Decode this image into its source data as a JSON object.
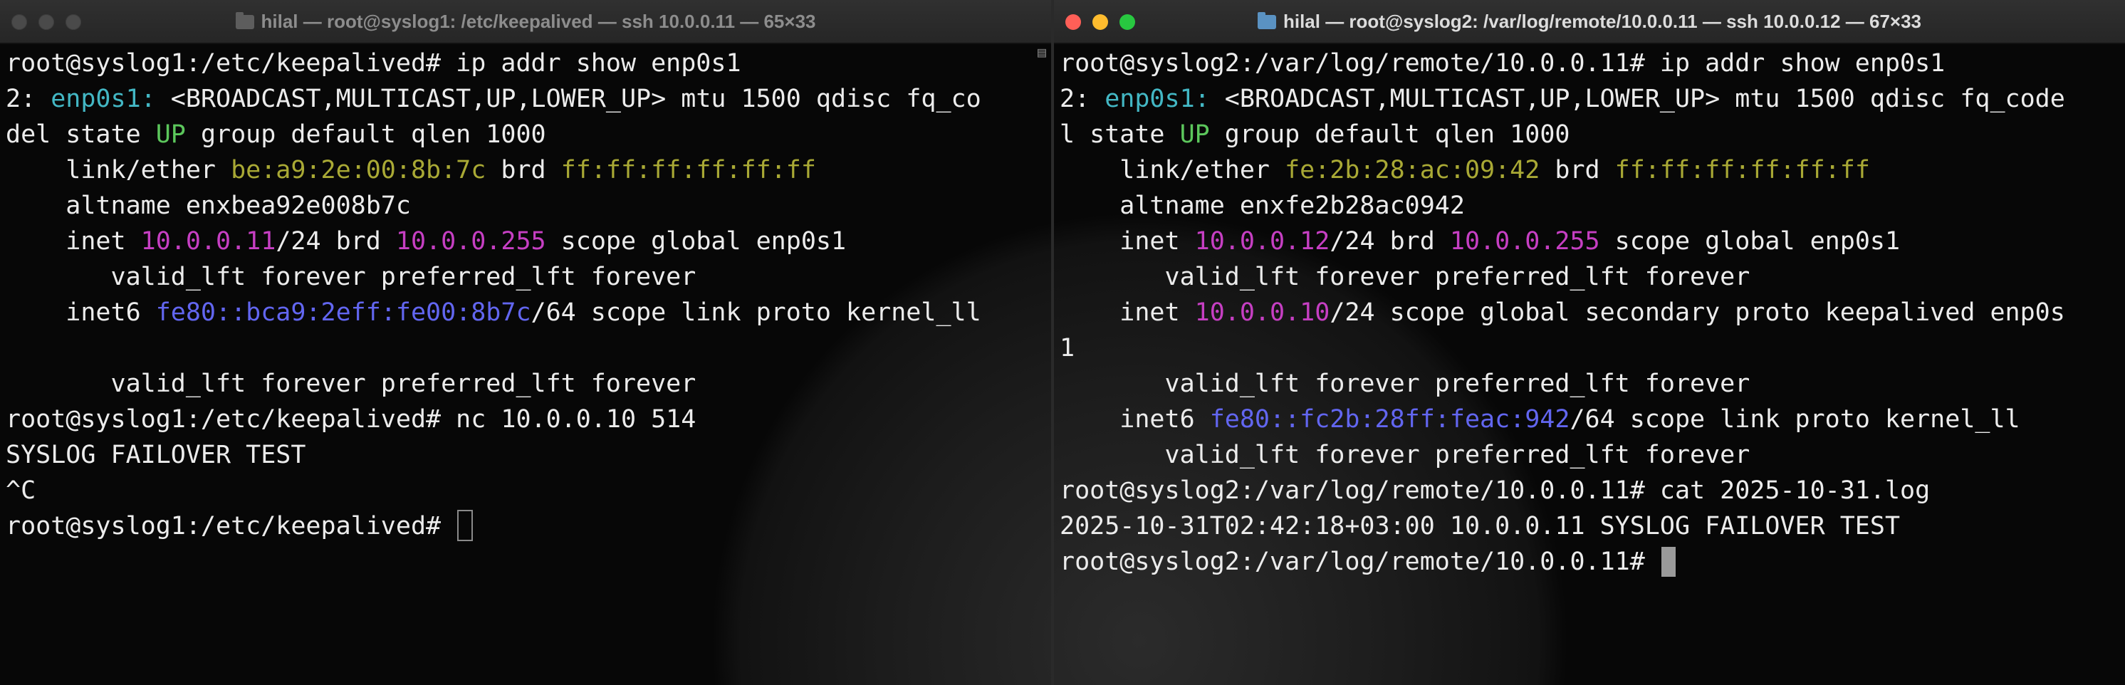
{
  "left_window": {
    "title": "hilal — root@syslog1: /etc/keepalived — ssh 10.0.0.11 — 65×33",
    "lines": [
      [
        {
          "t": "root@syslog1:/etc/keepalived# ip addr show enp0s1"
        }
      ],
      [
        {
          "t": "2: "
        },
        {
          "t": "enp0s1:",
          "c": "cyan"
        },
        {
          "t": " <BROADCAST,MULTICAST,UP,LOWER_UP> mtu 1500 qdisc fq_co"
        }
      ],
      [
        {
          "t": "del state "
        },
        {
          "t": "UP",
          "c": "green"
        },
        {
          "t": " group default qlen 1000"
        }
      ],
      [
        {
          "t": "    link/ether "
        },
        {
          "t": "be:a9:2e:00:8b:7c",
          "c": "yellow"
        },
        {
          "t": " brd "
        },
        {
          "t": "ff:ff:ff:ff:ff:ff",
          "c": "yellow"
        }
      ],
      [
        {
          "t": "    altname enxbea92e008b7c"
        }
      ],
      [
        {
          "t": "    inet "
        },
        {
          "t": "10.0.0.11",
          "c": "magenta"
        },
        {
          "t": "/24 brd "
        },
        {
          "t": "10.0.0.255",
          "c": "magenta"
        },
        {
          "t": " scope global enp0s1"
        }
      ],
      [
        {
          "t": "       valid_lft forever preferred_lft forever"
        }
      ],
      [
        {
          "t": "    inet6 "
        },
        {
          "t": "fe80::bca9:2eff:fe00:8b7c",
          "c": "blue"
        },
        {
          "t": "/64 scope link proto kernel_ll"
        }
      ],
      [
        {
          "t": ""
        }
      ],
      [
        {
          "t": "       valid_lft forever preferred_lft forever"
        }
      ],
      [
        {
          "t": "root@syslog1:/etc/keepalived# nc 10.0.0.10 514"
        }
      ],
      [
        {
          "t": "SYSLOG FAILOVER TEST"
        }
      ],
      [
        {
          "t": "^C"
        }
      ],
      [
        {
          "t": "root@syslog1:/etc/keepalived# "
        }
      ]
    ]
  },
  "right_window": {
    "title": "hilal — root@syslog2: /var/log/remote/10.0.0.11 — ssh 10.0.0.12 — 67×33",
    "lines": [
      [
        {
          "t": "root@syslog2:/var/log/remote/10.0.0.11# ip addr show enp0s1"
        }
      ],
      [
        {
          "t": "2: "
        },
        {
          "t": "enp0s1:",
          "c": "cyan"
        },
        {
          "t": " <BROADCAST,MULTICAST,UP,LOWER_UP> mtu 1500 qdisc fq_code"
        }
      ],
      [
        {
          "t": "l state "
        },
        {
          "t": "UP",
          "c": "green"
        },
        {
          "t": " group default qlen 1000"
        }
      ],
      [
        {
          "t": "    link/ether "
        },
        {
          "t": "fe:2b:28:ac:09:42",
          "c": "yellow"
        },
        {
          "t": " brd "
        },
        {
          "t": "ff:ff:ff:ff:ff:ff",
          "c": "yellow"
        }
      ],
      [
        {
          "t": "    altname enxfe2b28ac0942"
        }
      ],
      [
        {
          "t": "    inet "
        },
        {
          "t": "10.0.0.12",
          "c": "magenta"
        },
        {
          "t": "/24 brd "
        },
        {
          "t": "10.0.0.255",
          "c": "magenta"
        },
        {
          "t": " scope global enp0s1"
        }
      ],
      [
        {
          "t": "       valid_lft forever preferred_lft forever"
        }
      ],
      [
        {
          "t": "    inet "
        },
        {
          "t": "10.0.0.10",
          "c": "magenta"
        },
        {
          "t": "/24 scope global secondary proto keepalived enp0s"
        }
      ],
      [
        {
          "t": "1"
        }
      ],
      [
        {
          "t": "       valid_lft forever preferred_lft forever"
        }
      ],
      [
        {
          "t": "    inet6 "
        },
        {
          "t": "fe80::fc2b:28ff:feac:942",
          "c": "blue"
        },
        {
          "t": "/64 scope link proto kernel_ll"
        }
      ],
      [
        {
          "t": "       valid_lft forever preferred_lft forever"
        }
      ],
      [
        {
          "t": "root@syslog2:/var/log/remote/10.0.0.11# cat 2025-10-31.log"
        }
      ],
      [
        {
          "t": "2025-10-31T02:42:18+03:00 10.0.0.11 SYSLOG FAILOVER TEST"
        }
      ],
      [
        {
          "t": "root@syslog2:/var/log/remote/10.0.0.11# "
        }
      ]
    ]
  },
  "colors": {
    "cyan": "#43b7c4",
    "green": "#5cc75c",
    "yellow": "#a9a935",
    "magenta": "#c63fc3",
    "blue": "#6266f0",
    "foreground": "#ececec",
    "close": "#ff5f57",
    "minimize": "#febc2e",
    "zoom": "#28c840"
  }
}
